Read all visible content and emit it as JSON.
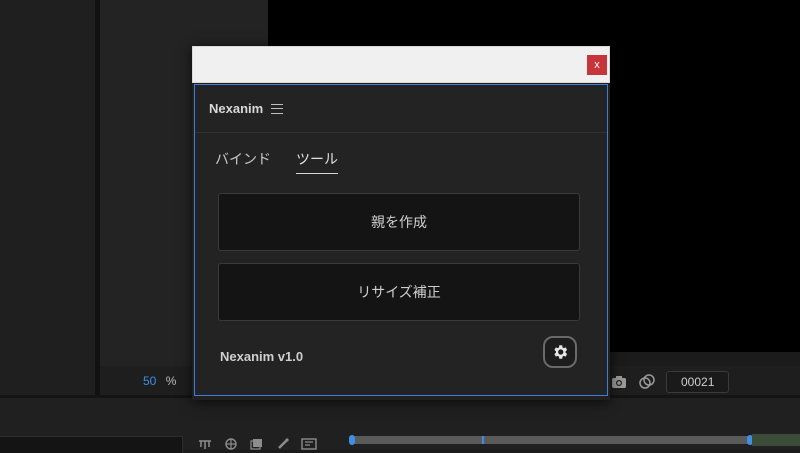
{
  "background": {
    "zoom_value": "50",
    "zoom_unit": "%",
    "timecode": "00021",
    "icons": [
      "camera-icon",
      "color-wheel-icon"
    ],
    "timeline_tools": [
      "network-icon",
      "globe-icon",
      "layers-icon",
      "paint-icon",
      "frame-icon"
    ]
  },
  "dialog": {
    "close_label": "x",
    "panel": {
      "title": "Nexanim",
      "tabs": [
        {
          "label": "バインド",
          "active": false
        },
        {
          "label": "ツール",
          "active": true
        }
      ],
      "buttons": {
        "create_parent": "親を作成",
        "resize_fix": "リサイズ補正"
      },
      "version": "Nexanim v1.0"
    }
  },
  "colors": {
    "accent": "#3f8ee8",
    "close": "#c7343a",
    "panel_border": "#3c7fd6"
  }
}
